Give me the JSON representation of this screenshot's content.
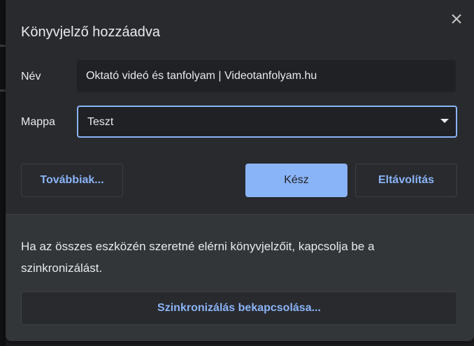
{
  "dialog": {
    "title": "Könyvjelző hozzáadva",
    "close_icon": "close-icon"
  },
  "form": {
    "name_label": "Név",
    "name_value": "Oktató videó és tanfolyam | Videotanfolyam.hu",
    "folder_label": "Mappa",
    "folder_value": "Teszt"
  },
  "buttons": {
    "more_label": "Továbbiak...",
    "done_label": "Kész",
    "remove_label": "Eltávolítás"
  },
  "sync": {
    "message": "Ha az összes eszközén szeretné elérni könyvjelzőit, kapcsolja be a szinkronizálást.",
    "button_label": "Szinkronizálás bekapcsolása..."
  },
  "colors": {
    "accent": "#8ab4f8",
    "dialog_bg": "#292a2d",
    "footer_bg": "#323639",
    "input_bg": "#202124",
    "text": "#e8eaed"
  }
}
